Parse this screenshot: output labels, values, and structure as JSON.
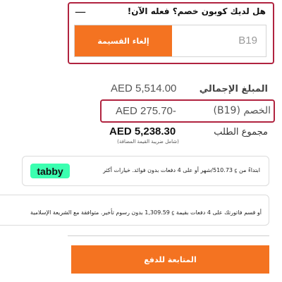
{
  "coupon": {
    "title": "هل لديك كوبون خصم؟ فعله الآن!",
    "collapse_glyph": "—",
    "code": "B19",
    "remove_label": "إلغاء القسيمة"
  },
  "summary": {
    "total_label": "المبلغ الإجمالي",
    "total_value": "AED  5,514.00",
    "discount_label": "الخصم (B19)",
    "discount_value": "AED  275.70-",
    "order_total_label": "مجموع الطلب",
    "order_total_value": "AED  5,238.30",
    "vat_note": "(شامل ضريبة القيمة المضافة)"
  },
  "tabby": {
    "logo": "tabby",
    "text": "ابتداءً من ⃀ 510.73/شهر أو على 4 دفعات بدون فوائد. خيارات أكثر"
  },
  "tamara": {
    "text": "أو قسم فاتورتك على 4 دفعات بقيمة ⃀ 1,309.59 بدون رسوم تأخير. متوافقة مع الشريعة الإسلامية"
  },
  "checkout": {
    "label": "المتابعة للدفع"
  },
  "colors": {
    "accent": "#f47321",
    "highlight_border": "#b0233f",
    "tabby_green": "#3bffb0"
  }
}
